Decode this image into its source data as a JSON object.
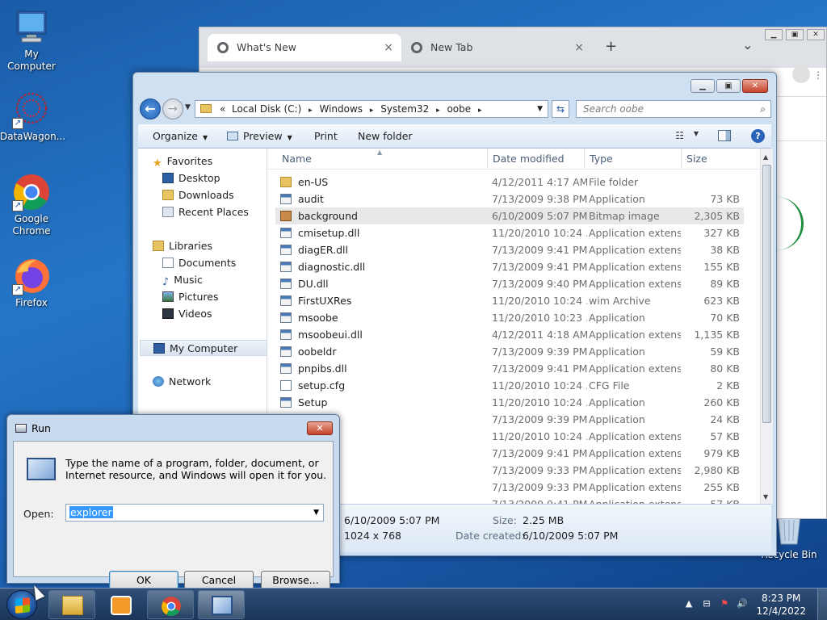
{
  "desktop": {
    "icons": [
      {
        "label": "My Computer"
      },
      {
        "label": "DataWagon..."
      },
      {
        "label": "Google Chrome"
      },
      {
        "label": "Firefox"
      },
      {
        "label": "Recycle Bin"
      }
    ]
  },
  "chrome": {
    "tabs": [
      {
        "label": "What's New"
      },
      {
        "label": "New Tab"
      }
    ],
    "new_tab": "+",
    "tab_menu": "⌄",
    "close": "×"
  },
  "explorer": {
    "breadcrumb": {
      "prefix": "«",
      "items": [
        "Local Disk (C:)",
        "Windows",
        "System32",
        "oobe"
      ],
      "sep": "▸"
    },
    "search_placeholder": "Search oobe",
    "toolbar": {
      "organize": "Organize",
      "preview": "Preview",
      "print": "Print",
      "new_folder": "New folder"
    },
    "nav": {
      "favorites": "Favorites",
      "desktop": "Desktop",
      "downloads": "Downloads",
      "recent": "Recent Places",
      "libraries": "Libraries",
      "documents": "Documents",
      "music": "Music",
      "pictures": "Pictures",
      "videos": "Videos",
      "computer": "My Computer",
      "network": "Network"
    },
    "columns": {
      "name": "Name",
      "date": "Date modified",
      "type": "Type",
      "size": "Size"
    },
    "files": [
      {
        "name": "en-US",
        "date": "4/12/2011 4:17 AM",
        "type": "File folder",
        "size": "",
        "icon": "folder"
      },
      {
        "name": "audit",
        "date": "7/13/2009 9:38 PM",
        "type": "Application",
        "size": "73 KB",
        "icon": "app"
      },
      {
        "name": "background",
        "date": "6/10/2009 5:07 PM",
        "type": "Bitmap image",
        "size": "2,305 KB",
        "icon": "img"
      },
      {
        "name": "cmisetup.dll",
        "date": "11/20/2010 10:24 ...",
        "type": "Application extens...",
        "size": "327 KB",
        "icon": "dll"
      },
      {
        "name": "diagER.dll",
        "date": "7/13/2009 9:41 PM",
        "type": "Application extens...",
        "size": "38 KB",
        "icon": "dll"
      },
      {
        "name": "diagnostic.dll",
        "date": "7/13/2009 9:41 PM",
        "type": "Application extens...",
        "size": "155 KB",
        "icon": "dll"
      },
      {
        "name": "DU.dll",
        "date": "7/13/2009 9:40 PM",
        "type": "Application extens...",
        "size": "89 KB",
        "icon": "dll"
      },
      {
        "name": "FirstUXRes",
        "date": "11/20/2010 10:24 ...",
        "type": "wim Archive",
        "size": "623 KB",
        "icon": "dll"
      },
      {
        "name": "msoobe",
        "date": "11/20/2010 10:23 ...",
        "type": "Application",
        "size": "70 KB",
        "icon": "app"
      },
      {
        "name": "msoobeui.dll",
        "date": "4/12/2011 4:18 AM",
        "type": "Application extens...",
        "size": "1,135 KB",
        "icon": "dll"
      },
      {
        "name": "oobeldr",
        "date": "7/13/2009 9:39 PM",
        "type": "Application",
        "size": "59 KB",
        "icon": "app"
      },
      {
        "name": "pnpibs.dll",
        "date": "7/13/2009 9:41 PM",
        "type": "Application extens...",
        "size": "80 KB",
        "icon": "dll"
      },
      {
        "name": "setup.cfg",
        "date": "11/20/2010 10:24 ...",
        "type": "CFG File",
        "size": "2 KB",
        "icon": "txt"
      },
      {
        "name": "Setup",
        "date": "11/20/2010 10:24 ...",
        "type": "Application",
        "size": "260 KB",
        "icon": "app"
      },
      {
        "name": "",
        "date": "7/13/2009 9:39 PM",
        "type": "Application",
        "size": "24 KB",
        "icon": "app"
      },
      {
        "name": "ll",
        "date": "11/20/2010 10:24 ...",
        "type": "Application extens...",
        "size": "57 KB",
        "icon": "dll"
      },
      {
        "name": "",
        "date": "7/13/2009 9:41 PM",
        "type": "Application extens...",
        "size": "979 KB",
        "icon": "dll"
      },
      {
        "name": "g.dll",
        "date": "7/13/2009 9:33 PM",
        "type": "Application extens...",
        "size": "2,980 KB",
        "icon": "dll"
      },
      {
        "name": ".dll",
        "date": "7/13/2009 9:33 PM",
        "type": "Application extens...",
        "size": "255 KB",
        "icon": "dll"
      },
      {
        "name": "",
        "date": "7/13/2009 9:41 PM",
        "type": "Application extens...",
        "size": "57 KB",
        "icon": "dll"
      }
    ],
    "details": {
      "modified": "6/10/2009 5:07 PM",
      "size_label": "Size:",
      "size": "2.25 MB",
      "dims": "1024 x 768",
      "created_label": "Date created:",
      "created": "6/10/2009 5:07 PM"
    }
  },
  "run": {
    "title": "Run",
    "close": "✕",
    "description": "Type the name of a program, folder, document, or Internet resource, and Windows will open it for you.",
    "open_label": "Open:",
    "open_value": "explorer",
    "ok": "OK",
    "cancel": "Cancel",
    "browse": "Browse..."
  },
  "taskbar": {
    "time": "8:23 PM",
    "date": "12/4/2022"
  }
}
